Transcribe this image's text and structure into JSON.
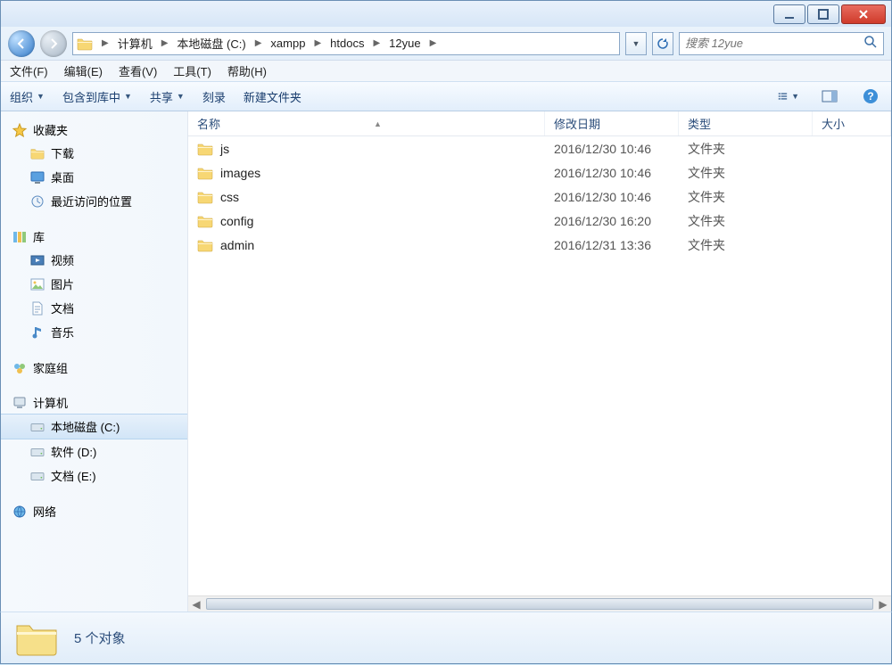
{
  "breadcrumb": [
    "计算机",
    "本地磁盘 (C:)",
    "xampp",
    "htdocs",
    "12yue"
  ],
  "search_placeholder": "搜索 12yue",
  "menubar": {
    "file": "文件(F)",
    "edit": "编辑(E)",
    "view": "查看(V)",
    "tools": "工具(T)",
    "help": "帮助(H)"
  },
  "toolbar": {
    "organize": "组织",
    "include": "包含到库中",
    "share": "共享",
    "burn": "刻录",
    "newfolder": "新建文件夹"
  },
  "columns": {
    "name": "名称",
    "date": "修改日期",
    "type": "类型",
    "size": "大小"
  },
  "sidebar": {
    "favorites": {
      "label": "收藏夹",
      "items": [
        {
          "label": "下载",
          "icon": "download"
        },
        {
          "label": "桌面",
          "icon": "desktop"
        },
        {
          "label": "最近访问的位置",
          "icon": "recent"
        }
      ]
    },
    "libraries": {
      "label": "库",
      "items": [
        {
          "label": "视频",
          "icon": "video"
        },
        {
          "label": "图片",
          "icon": "picture"
        },
        {
          "label": "文档",
          "icon": "document"
        },
        {
          "label": "音乐",
          "icon": "music"
        }
      ]
    },
    "homegroup": {
      "label": "家庭组"
    },
    "computer": {
      "label": "计算机",
      "items": [
        {
          "label": "本地磁盘 (C:)",
          "icon": "drive",
          "selected": true
        },
        {
          "label": "软件 (D:)",
          "icon": "drive"
        },
        {
          "label": "文档 (E:)",
          "icon": "drive"
        }
      ]
    },
    "network": {
      "label": "网络"
    }
  },
  "files": [
    {
      "name": "js",
      "date": "2016/12/30 10:46",
      "type": "文件夹"
    },
    {
      "name": "images",
      "date": "2016/12/30 10:46",
      "type": "文件夹"
    },
    {
      "name": "css",
      "date": "2016/12/30 10:46",
      "type": "文件夹"
    },
    {
      "name": "config",
      "date": "2016/12/30 16:20",
      "type": "文件夹"
    },
    {
      "name": "admin",
      "date": "2016/12/31 13:36",
      "type": "文件夹"
    }
  ],
  "status": "5 个对象"
}
